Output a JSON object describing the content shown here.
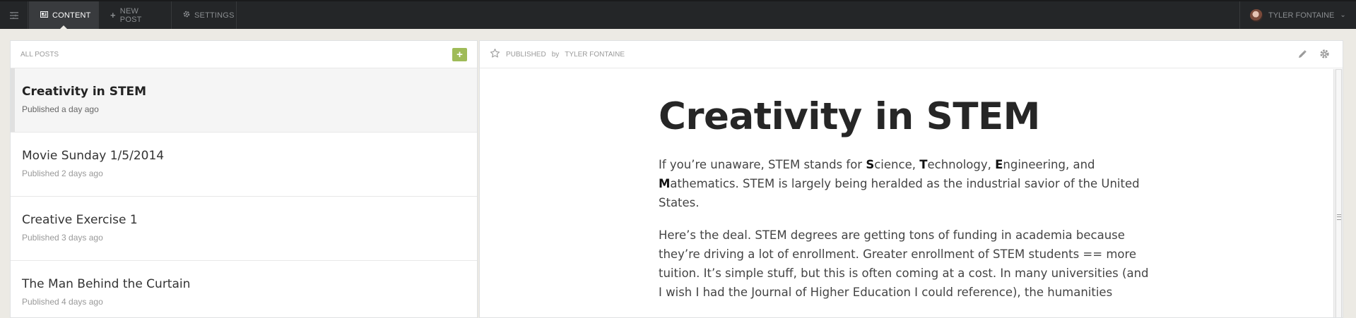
{
  "nav": {
    "items": [
      {
        "label": "Content",
        "icon": "content-icon",
        "active": true
      },
      {
        "label": "New Post",
        "icon": "plus-icon",
        "active": false
      },
      {
        "label": "Settings",
        "icon": "gear-icon",
        "active": false
      }
    ],
    "user": {
      "name": "Tyler Fontaine"
    }
  },
  "post_list": {
    "header": "All Posts",
    "posts": [
      {
        "title": "Creativity in STEM",
        "meta": "Published a day ago",
        "selected": true
      },
      {
        "title": "Movie Sunday 1/5/2014",
        "meta": "Published 2 days ago",
        "selected": false
      },
      {
        "title": "Creative Exercise 1",
        "meta": "Published 3 days ago",
        "selected": false
      },
      {
        "title": "The Man Behind the Curtain",
        "meta": "Published 4 days ago",
        "selected": false
      }
    ]
  },
  "preview": {
    "status": "Published",
    "by": "by",
    "author": "Tyler Fontaine",
    "title": "Creativity in STEM",
    "paragraph1": {
      "before_s": "If you’re unaware, STEM stands for ",
      "s": "S",
      "after_s": "cience, ",
      "t": "T",
      "after_t": "echnology, ",
      "e": "E",
      "after_e": "ngineering, and",
      "m": "M",
      "after_m": "athematics. STEM is largely being heralded as the industrial savior of the United States."
    },
    "paragraph2": "Here’s the deal. STEM degrees are getting tons of funding in academia because they’re driving a lot of enrollment. Greater enrollment of STEM students == more tuition. It’s simple stuff, but this is often coming at a cost. In many universities (and I wish I had the Journal of Higher Education I could reference), the humanities"
  },
  "colors": {
    "topbar": "#242628",
    "accent_green": "#9fbb58",
    "background": "#eceae4"
  }
}
